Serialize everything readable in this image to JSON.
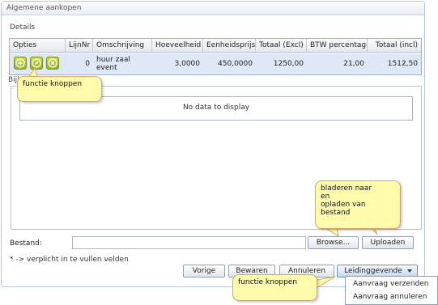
{
  "panel": {
    "title": "Algemene aankopen"
  },
  "details": {
    "label": "Details",
    "columns": [
      "Opties",
      "LijnNr",
      "Omschrijving",
      "Hoeveelheid",
      "Eenheidsprijs",
      "Totaal (Excl)",
      "BTW percentage",
      "Totaal (incl)"
    ],
    "row": {
      "lijnnr": "0",
      "omschrijving": "huur zaal event",
      "hoeveelheid": "3,0000",
      "eenheidsprijs": "450,0000",
      "totaal_excl": "1250,00",
      "btw": "21,00",
      "totaal_incl": "1512,50"
    },
    "option_icons": [
      "add-icon",
      "edit-icon",
      "cancel-icon"
    ],
    "accent_color": "#a7c02a"
  },
  "bijlagen": {
    "label": "Bijlagen",
    "empty_text": "No data to display"
  },
  "file": {
    "label": "Bestand:",
    "browse_label": "Browse...",
    "upload_label": "Uploaden"
  },
  "required_note": "* -> verplicht in te vullen velden",
  "actions": {
    "vorige": "Vorige",
    "bewaren": "Bewaren",
    "annuleren": "Annuleren",
    "leidinggevende": "Leidinggevende"
  },
  "menu": {
    "items": [
      "Aanvraag verzenden",
      "Aanvraag annuleren"
    ]
  },
  "callouts": {
    "functie_knoppen_top": "functie knoppen",
    "bladeren": [
      "bladeren naar",
      "en",
      "opladen van",
      "bestand"
    ],
    "functie_knoppen_bottom": "functie knoppen"
  }
}
